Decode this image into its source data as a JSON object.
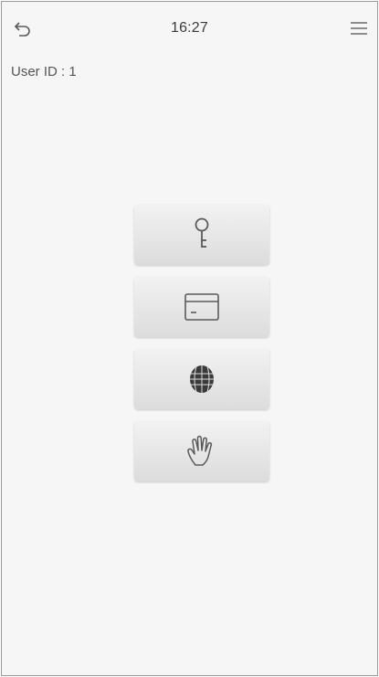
{
  "status_bar": {
    "time": "16:27",
    "back_icon": "back-arrow-icon",
    "menu_icon": "menu-icon"
  },
  "user": {
    "id_label": "User ID : 1"
  },
  "verification_options": [
    {
      "name": "password",
      "icon": "key-icon"
    },
    {
      "name": "card",
      "icon": "card-icon"
    },
    {
      "name": "face",
      "icon": "face-icon"
    },
    {
      "name": "palm",
      "icon": "palm-icon"
    }
  ],
  "colors": {
    "background": "#f6f6f6",
    "button_top": "#f2f2f2",
    "button_bottom": "#dcdcdc",
    "icon_stroke": "#5a5a5a",
    "text": "#555555"
  }
}
